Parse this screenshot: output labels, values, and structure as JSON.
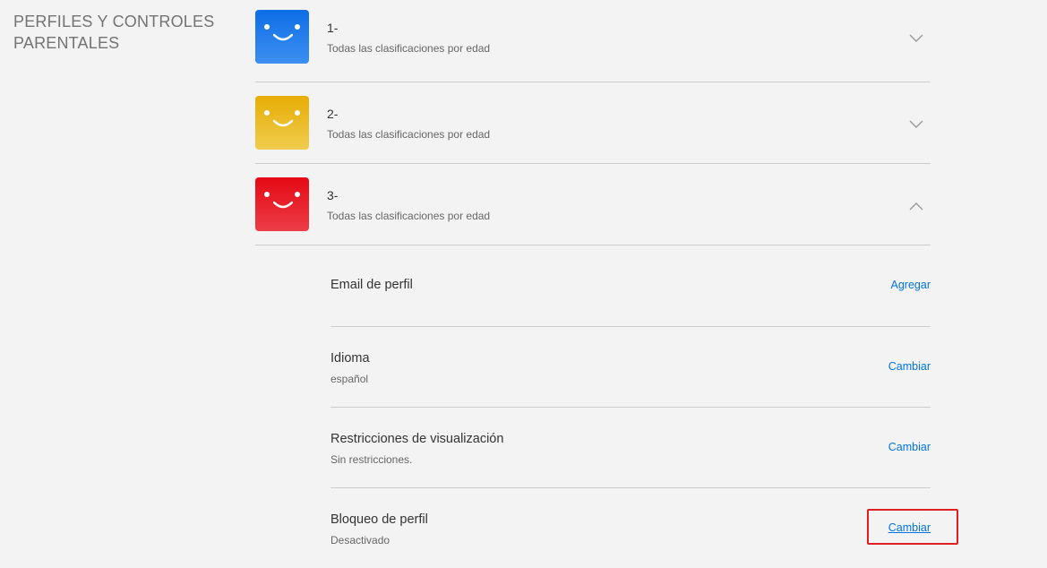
{
  "section": {
    "title": "PERFILES Y CONTROLES PARENTALES"
  },
  "profiles": [
    {
      "name": "1-",
      "subtitle": "Todas las clasificaciones por edad",
      "color": "#1170e6",
      "expanded": false,
      "icon": "chevron-down-icon"
    },
    {
      "name": "2-",
      "subtitle": "Todas las clasificaciones por edad",
      "color": "#e8ae0a",
      "expanded": false,
      "icon": "chevron-down-icon"
    },
    {
      "name": "3-",
      "subtitle": "Todas las clasificaciones por edad",
      "color": "#e50914",
      "expanded": true,
      "icon": "chevron-up-icon"
    }
  ],
  "settings": [
    {
      "label": "Email de perfil",
      "value": "",
      "action": "Agregar"
    },
    {
      "label": "Idioma",
      "value": "español",
      "action": "Cambiar"
    },
    {
      "label": "Restricciones de visualización",
      "value": "Sin restricciones.",
      "action": "Cambiar"
    },
    {
      "label": "Bloqueo de perfil",
      "value": "Desactivado",
      "action": "Cambiar"
    }
  ],
  "colors": {
    "link": "#0073e6",
    "highlight": "#e02020",
    "divider": "#cccccc"
  }
}
